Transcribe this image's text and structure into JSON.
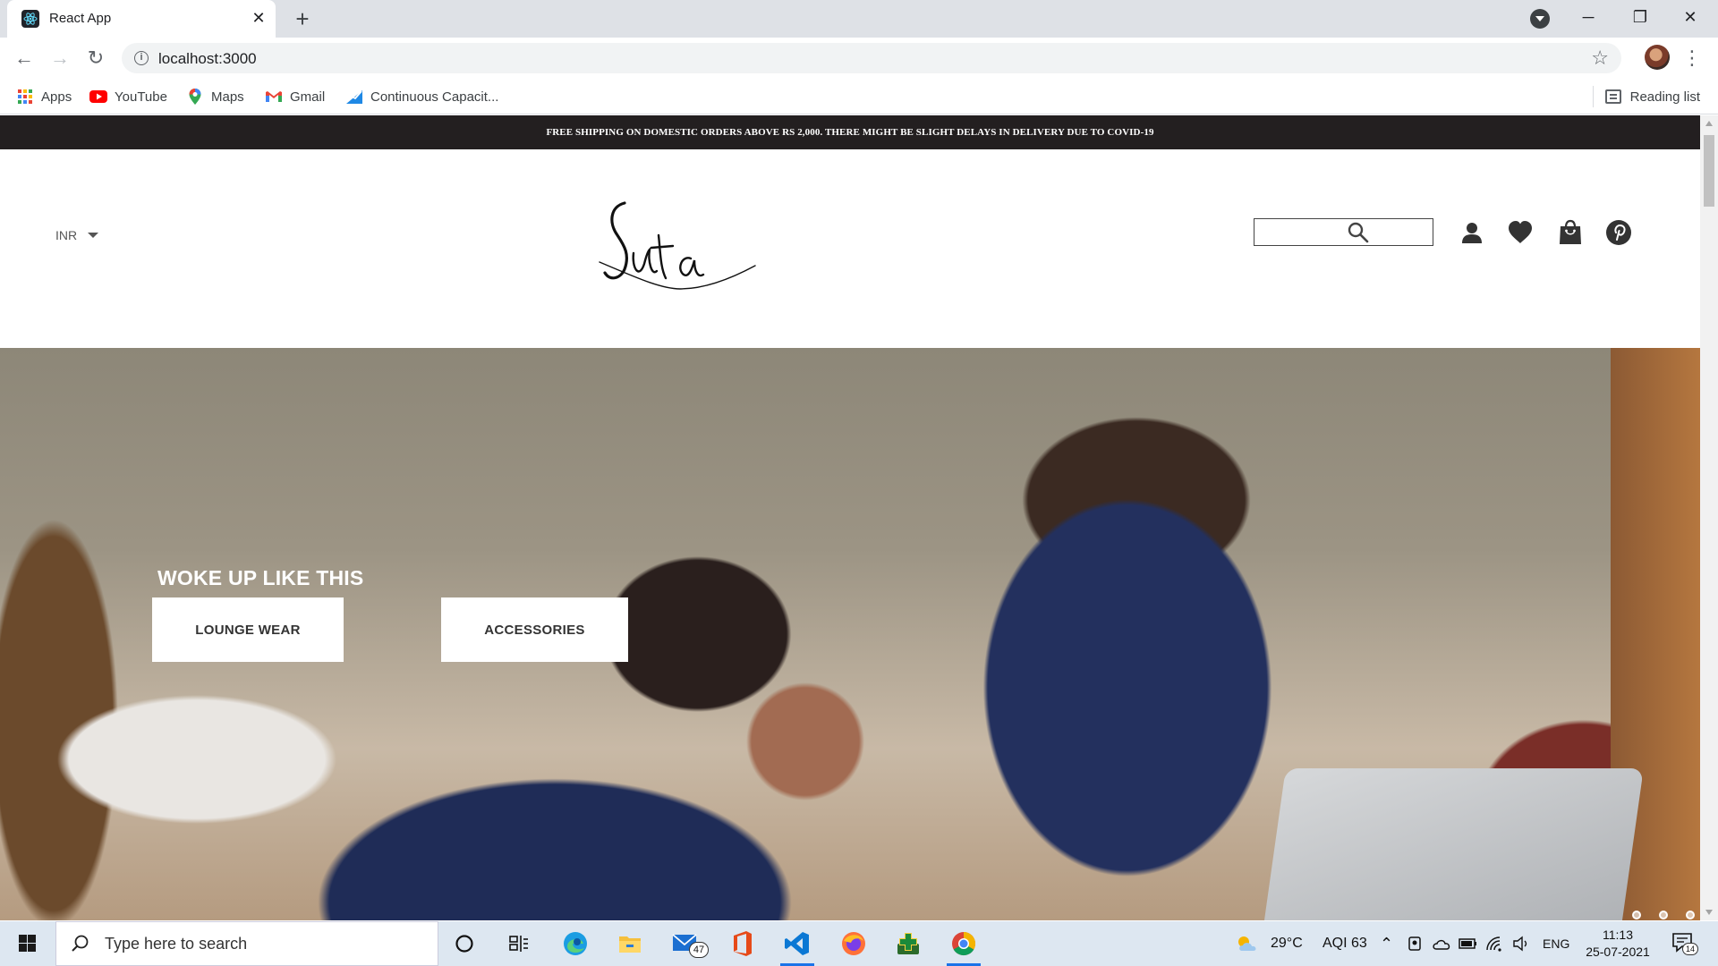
{
  "browser": {
    "tab_title": "React App",
    "url": "localhost:3000",
    "bookmarks": [
      {
        "label": "Apps",
        "icon": "apps-grid-icon"
      },
      {
        "label": "YouTube",
        "icon": "youtube-icon"
      },
      {
        "label": "Maps",
        "icon": "maps-pin-icon"
      },
      {
        "label": "Gmail",
        "icon": "gmail-icon"
      },
      {
        "label": "Continuous Capacit...",
        "icon": "chart-icon"
      }
    ],
    "reading_list": "Reading list"
  },
  "site": {
    "announcement": "FREE SHIPPING ON DOMESTIC ORDERS ABOVE RS 2,000. THERE MIGHT BE SLIGHT DELAYS IN DELIVERY DUE TO COVID-19",
    "currency": "INR",
    "logo_text": "Suta",
    "search_placeholder": "",
    "header_icons": [
      "user-icon",
      "heart-icon",
      "shopping-bag-icon",
      "pinterest-icon"
    ],
    "hero": {
      "title": "WOKE UP LIKE THIS",
      "buttons": [
        "LOUNGE WEAR",
        "ACCESSORIES"
      ],
      "slides": 3
    }
  },
  "taskbar": {
    "search_placeholder": "Type here to search",
    "mail_badge": "47",
    "weather": "29°C",
    "aqi": "AQI 63",
    "language": "ENG",
    "time": "11:13",
    "date": "25-07-2021",
    "notifications": "14"
  },
  "colors": {
    "announcement_bg": "#231f20",
    "tabstrip_bg": "#dee1e6",
    "taskbar_bg": "#dde7f1",
    "accent": "#1a73e8"
  }
}
